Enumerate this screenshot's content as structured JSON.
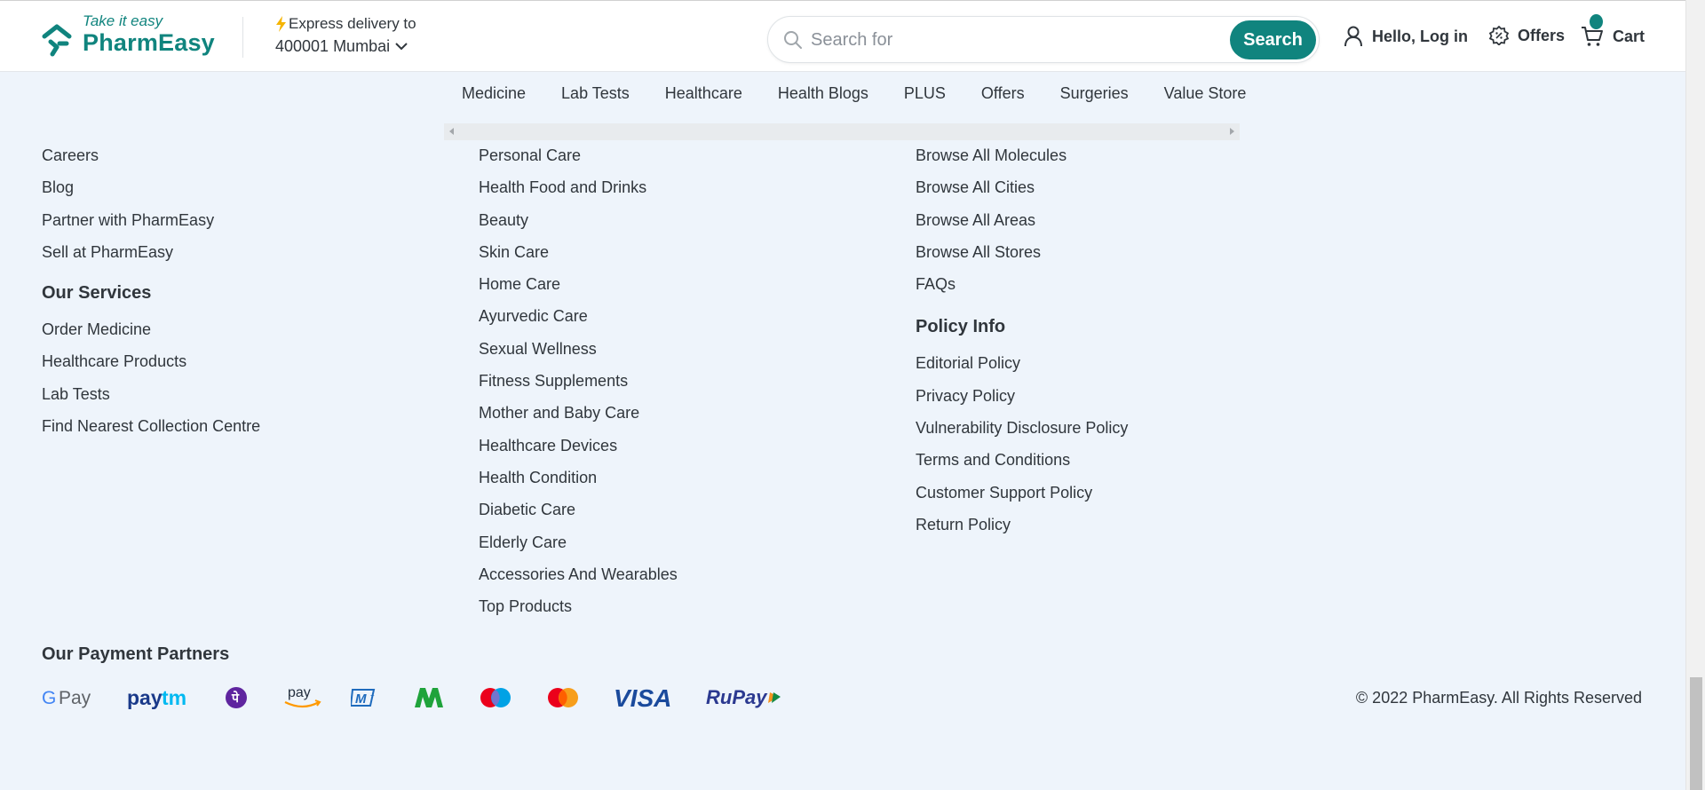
{
  "header": {
    "logo_tagline": "Take it easy",
    "logo_name": "PharmEasy",
    "delivery_label": "Express delivery to",
    "delivery_location": "400001 Mumbai",
    "search_placeholder": "Search for",
    "search_button": "Search",
    "login_label": "Hello, Log in",
    "offers_label": "Offers",
    "cart_label": "Cart"
  },
  "nav": {
    "items": [
      "Medicine",
      "Lab Tests",
      "Healthcare",
      "Health Blogs",
      "PLUS",
      "Offers",
      "Surgeries",
      "Value Store"
    ]
  },
  "footer": {
    "col1_links": [
      "Careers",
      "Blog",
      "Partner with PharmEasy",
      "Sell at PharmEasy"
    ],
    "services_heading": "Our Services",
    "services_links": [
      "Order Medicine",
      "Healthcare Products",
      "Lab Tests",
      "Find Nearest Collection Centre"
    ],
    "col2_links": [
      "Personal Care",
      "Health Food and Drinks",
      "Beauty",
      "Skin Care",
      "Home Care",
      "Ayurvedic Care",
      "Sexual Wellness",
      "Fitness Supplements",
      "Mother and Baby Care",
      "Healthcare Devices",
      "Health Condition",
      "Diabetic Care",
      "Elderly Care",
      "Accessories And Wearables",
      "Top Products"
    ],
    "col3_links": [
      "Browse All Molecules",
      "Browse All Cities",
      "Browse All Areas",
      "Browse All Stores",
      "FAQs"
    ],
    "policy_heading": "Policy Info",
    "policy_links": [
      "Editorial Policy",
      "Privacy Policy",
      "Vulnerability Disclosure Policy",
      "Terms and Conditions",
      "Customer Support Policy",
      "Return Policy"
    ],
    "payment_heading": "Our Payment Partners",
    "payment_partners": [
      "G Pay",
      "paytm",
      "PhonePe",
      "amazon pay",
      "MobiKwik",
      "Mobikwik M",
      "Maestro",
      "Mastercard",
      "VISA",
      "RuPay"
    ],
    "copyright": "© 2022 PharmEasy. All Rights Reserved"
  },
  "colors": {
    "brand": "#10847e",
    "background": "#eef4fb",
    "text": "#30363c"
  },
  "icons": [
    "pharmeasy-logo-icon",
    "lightning-bolt-icon",
    "chevron-down-icon",
    "search-icon",
    "user-icon",
    "offers-icon",
    "cart-icon"
  ]
}
